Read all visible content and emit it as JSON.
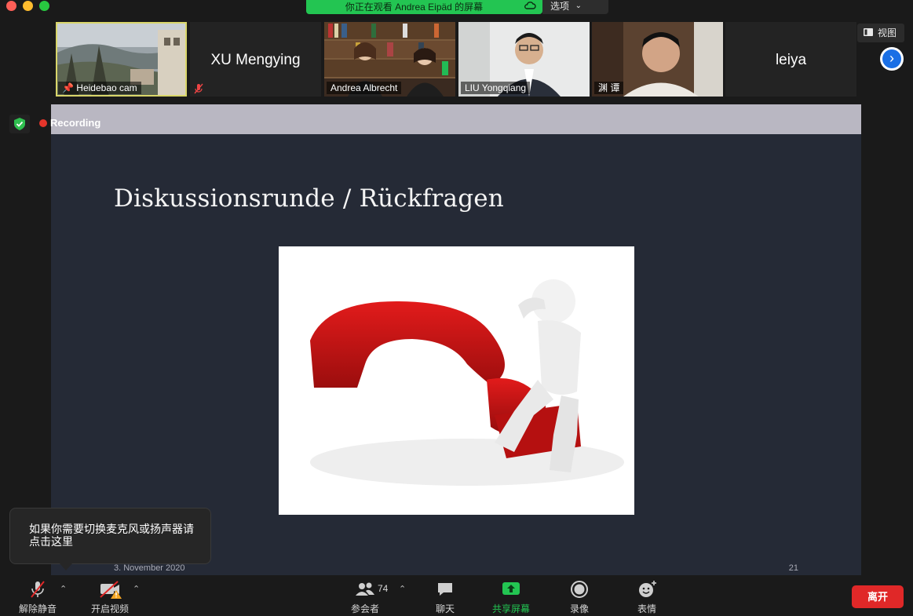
{
  "window": {
    "share_banner": "你正在观看 Andrea Eipäd 的屏幕",
    "options_label": "选项"
  },
  "participants": [
    {
      "name": "Heidebao cam",
      "type": "video",
      "pinned": true,
      "active_speaker": true
    },
    {
      "name": "XU Mengying",
      "type": "name-only",
      "muted": false
    },
    {
      "name": "Andrea Albrecht",
      "type": "video"
    },
    {
      "name": "LIU Yongqiang",
      "type": "video"
    },
    {
      "name": "渊 谭",
      "type": "video",
      "muted": true
    },
    {
      "name": "leiya",
      "type": "name-only"
    }
  ],
  "view_button": "视图",
  "recording": {
    "label": "Recording"
  },
  "slide": {
    "title": "Diskussionsrunde / Rückfragen",
    "date": "3. November 2020",
    "page": "21"
  },
  "tooltip": "如果你需要切换麦克风或扬声器请点击这里",
  "toolbar": {
    "unmute": "解除静音",
    "start_video": "开启视频",
    "participants": "参会者",
    "participant_count": "74",
    "chat": "聊天",
    "share_screen": "共享屏幕",
    "record": "录像",
    "reactions": "表情",
    "leave": "离开"
  },
  "colors": {
    "share_green": "#23c552",
    "leave_red": "#e02828",
    "active_speaker": "#d9d66a",
    "slide_bg": "#252a36",
    "recording_dot": "#e5352b"
  }
}
